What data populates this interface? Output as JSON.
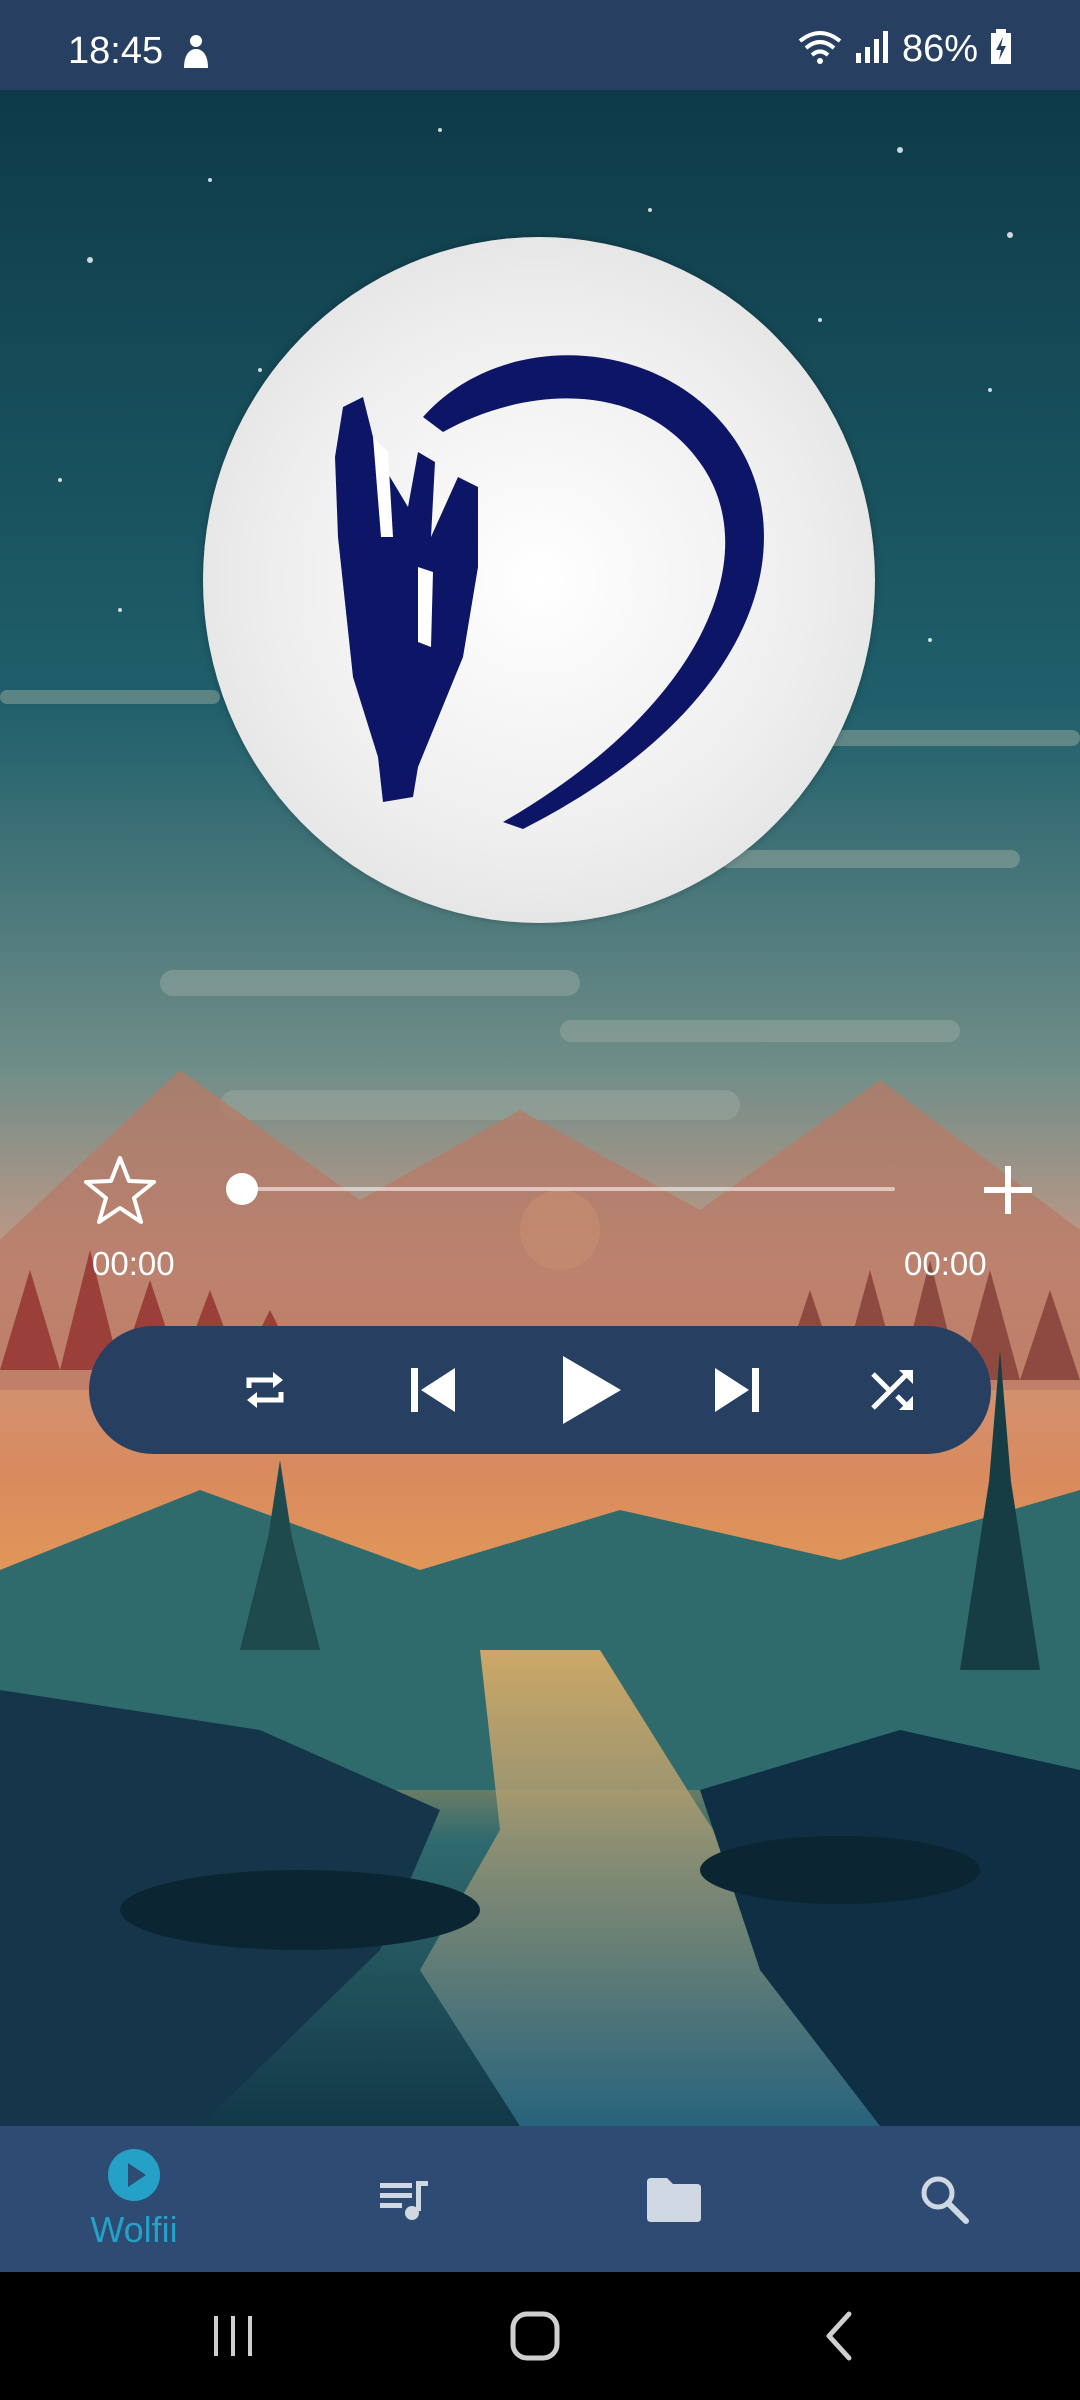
{
  "status_bar": {
    "time": "18:45",
    "battery": "86%",
    "icons": [
      "person-icon",
      "wifi-icon",
      "signal-icon",
      "battery-icon"
    ]
  },
  "player": {
    "elapsed": "00:00",
    "duration": "00:00",
    "progress": 0
  },
  "controls": [
    "repeat-icon",
    "previous-icon",
    "play-icon",
    "next-icon",
    "shuffle-icon"
  ],
  "bottom_nav": {
    "items": [
      {
        "label": "Wolfii",
        "icon": "play-circle-icon",
        "active": true
      },
      {
        "label": "",
        "icon": "queue-music-icon"
      },
      {
        "label": "",
        "icon": "folder-icon"
      },
      {
        "label": "",
        "icon": "search-icon"
      }
    ]
  },
  "colors": {
    "bar": "#274062",
    "accent": "#25a0c6",
    "logo": "#0d1566"
  }
}
